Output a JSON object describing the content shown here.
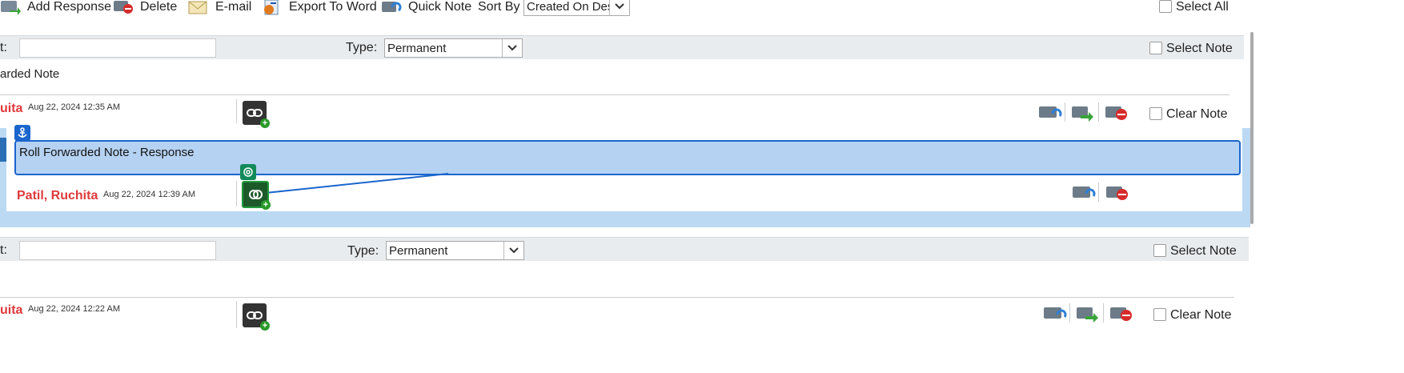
{
  "toolbar": {
    "add_response": "Add Response",
    "delete": "Delete",
    "email": "E-mail",
    "export": "Export To Word",
    "quick_note": "Quick Note",
    "sort_by_label": "Sort By",
    "sort_by_value": "Created On Desc",
    "select_all": "Select All"
  },
  "notes": [
    {
      "subject_label": "t:",
      "type_label": "Type:",
      "type_value": "Permanent",
      "select_note": "Select Note",
      "title": "arded Note",
      "author": "uita",
      "date": "Aug 22, 2024 12:35 AM",
      "clear_note": "Clear Note"
    },
    {
      "subject_label": "t:",
      "type_label": "Type:",
      "type_value": "Permanent",
      "select_note": "Select Note",
      "title": "",
      "author": "uita",
      "date": "Aug 22, 2024 12:22 AM",
      "clear_note": "Clear Note"
    }
  ],
  "response": {
    "title": "Roll Forwarded Note - Response",
    "author": "Patil, Ruchita",
    "date": "Aug 22, 2024 12:39 AM"
  },
  "colors": {
    "accent": "#1a66cc",
    "response_bg": "#b8d4f0",
    "author": "#e0393b",
    "header_bg": "#e9ecef"
  }
}
